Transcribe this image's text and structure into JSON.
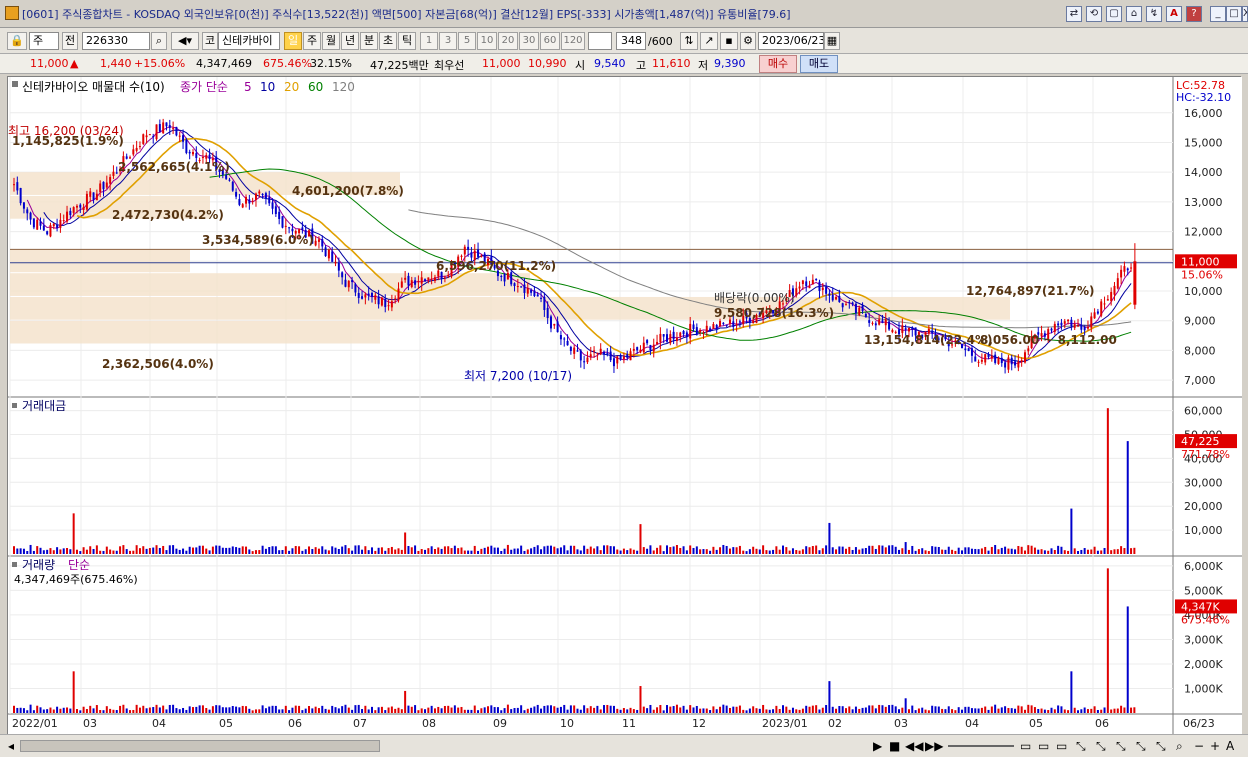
{
  "window": {
    "title": "[0601] 주식종합차트 - KOSDAQ 외국인보유[0(천)] 주식수[13,522(천)] 액면[500] 자본금[68(억)] 결산[12월] EPS[-333] 시가총액[1,487(억)] 유통비율[79.6]",
    "buttons": [
      "⇄",
      "⟲",
      "▢",
      "⌂",
      "↯",
      "A",
      "?",
      "_",
      "□",
      "X"
    ]
  },
  "toolbar": {
    "market": "주",
    "all_label": "전",
    "code": "226330",
    "company_prefix": "코",
    "company_name": "신테카바이",
    "periods": [
      "일",
      "주",
      "월",
      "년",
      "분",
      "초",
      "틱"
    ],
    "selected_period": "일",
    "intervals": [
      "1",
      "3",
      "5",
      "10",
      "20",
      "30",
      "60",
      "120"
    ],
    "count": "348",
    "count_total": "/600",
    "date": "2023/06/23"
  },
  "quote": {
    "price": "11,000",
    "change": "1,440",
    "change_pct": "+15.06%",
    "volume": "4,347,469",
    "volume_ratio": "675.46%",
    "turnover": "32.15%",
    "amount": "47,225백만",
    "best_label": "최우선",
    "ask": "11,000",
    "bid": "10,990",
    "open_label": "시",
    "open": "9,540",
    "high_label": "고",
    "high": "11,610",
    "low_label": "저",
    "low": "9,390",
    "buy_label": "매수",
    "sell_label": "매도"
  },
  "legend": {
    "price_title": "신테카바이오 매물대 수(10)",
    "ma_label": "종가 단순",
    "ma_periods": [
      "5",
      "10",
      "20",
      "60",
      "120"
    ],
    "lc": "LC:52.78",
    "hc": "HC:-32.10",
    "amount_title": "거래대금",
    "volume_title": "거래량",
    "volume_ma_label": "단순",
    "volume_info": "4,347,469주(675.46%)"
  },
  "colors": {
    "up": "#e00000",
    "down": "#0000cc",
    "ma5": "#9a009a",
    "ma10": "#0000a0",
    "ma20": "#e0a000",
    "ma60": "#008000",
    "ma120": "#808080",
    "band": "#f5e3cc"
  },
  "annotations": {
    "high": "최고 16,200 (03/24)",
    "low": "최저 7,200 (10/17)",
    "dividend": "배당락(0.00%)",
    "bands": [
      "1,145,825(1.9%)",
      "2,562,665(4.1%)",
      "4,601,200(7.8%)",
      "2,472,730(4.2%)",
      "3,534,589(6.0%)",
      "6,596,270(11.2%)",
      "9,580,728(16.3%)",
      "12,764,897(21.7%)",
      "13,154,814(22.4%)",
      "8,056.00 ~ 8,112.00",
      "2,362,506(4.0%)"
    ]
  },
  "axes": {
    "price_ticks": [
      "16,000",
      "15,000",
      "14,000",
      "13,000",
      "12,000",
      "11,000",
      "10,000",
      "9,000",
      "8,000",
      "7,000"
    ],
    "current_price": "11,000",
    "current_pct": "15.06%",
    "amount_ticks": [
      "60,000",
      "50,000",
      "40,000",
      "30,000",
      "20,000",
      "10,000"
    ],
    "current_amount": "47,225",
    "current_amount_pct": "771.78%",
    "volume_ticks": [
      "6,000K",
      "5,000K",
      "4,000K",
      "3,000K",
      "2,000K",
      "1,000K"
    ],
    "current_volume": "4,347K",
    "current_volume_pct": "675.46%",
    "x_labels": [
      "2022/01",
      "03",
      "04",
      "05",
      "06",
      "07",
      "08",
      "09",
      "10",
      "11",
      "12",
      "2023/01",
      "02",
      "03",
      "04",
      "05",
      "06"
    ],
    "x_right": "06/23"
  },
  "chart_data": {
    "type": "candlestick",
    "title": "신테카바이오 매물대 수(10)",
    "x_range": [
      "2022/01",
      "2023/06/23"
    ],
    "price_ylim": [
      6500,
      16800
    ],
    "price_path": [
      [
        0,
        13600
      ],
      [
        5,
        12400
      ],
      [
        10,
        12000
      ],
      [
        18,
        12800
      ],
      [
        25,
        13300
      ],
      [
        32,
        14200
      ],
      [
        40,
        15300
      ],
      [
        47,
        15600
      ],
      [
        52,
        14800
      ],
      [
        58,
        14500
      ],
      [
        64,
        13800
      ],
      [
        68,
        13000
      ],
      [
        74,
        13200
      ],
      [
        80,
        12400
      ],
      [
        86,
        12000
      ],
      [
        92,
        11700
      ],
      [
        96,
        11000
      ],
      [
        100,
        10300
      ],
      [
        106,
        9800
      ],
      [
        112,
        9600
      ],
      [
        118,
        10300
      ],
      [
        124,
        10500
      ],
      [
        130,
        10600
      ],
      [
        136,
        11500
      ],
      [
        142,
        11000
      ],
      [
        146,
        10600
      ],
      [
        152,
        10300
      ],
      [
        158,
        9800
      ],
      [
        162,
        8900
      ],
      [
        166,
        8200
      ],
      [
        172,
        7600
      ],
      [
        176,
        7900
      ],
      [
        182,
        7600
      ],
      [
        188,
        8000
      ],
      [
        196,
        8400
      ],
      [
        204,
        8700
      ],
      [
        212,
        8800
      ],
      [
        220,
        9000
      ],
      [
        226,
        9300
      ],
      [
        232,
        9600
      ],
      [
        238,
        10400
      ],
      [
        243,
        10200
      ],
      [
        248,
        9700
      ],
      [
        254,
        9300
      ],
      [
        260,
        9000
      ],
      [
        266,
        8700
      ],
      [
        272,
        8600
      ],
      [
        278,
        8500
      ],
      [
        284,
        8200
      ],
      [
        290,
        7800
      ],
      [
        296,
        7600
      ],
      [
        302,
        7600
      ],
      [
        308,
        8400
      ],
      [
        314,
        8900
      ],
      [
        318,
        9000
      ],
      [
        322,
        8700
      ],
      [
        328,
        9600
      ],
      [
        332,
        10200
      ],
      [
        337,
        11000
      ]
    ],
    "high_point": {
      "date": "03/24",
      "value": 16200
    },
    "low_point": {
      "date": "10/17",
      "value": 7200
    },
    "amount_ylim": [
      0,
      64000
    ],
    "amount_spikes": [
      [
        18,
        17000
      ],
      [
        118,
        9000
      ],
      [
        189,
        12500
      ],
      [
        246,
        13000
      ],
      [
        269,
        5000
      ],
      [
        319,
        19000
      ],
      [
        330,
        61000
      ],
      [
        336,
        47225
      ]
    ],
    "volume_ylim": [
      0,
      6200
    ],
    "volume_spikes": [
      [
        18,
        1700
      ],
      [
        118,
        900
      ],
      [
        189,
        1100
      ],
      [
        246,
        1300
      ],
      [
        269,
        600
      ],
      [
        319,
        1700
      ],
      [
        330,
        5900
      ],
      [
        336,
        4347
      ]
    ]
  }
}
